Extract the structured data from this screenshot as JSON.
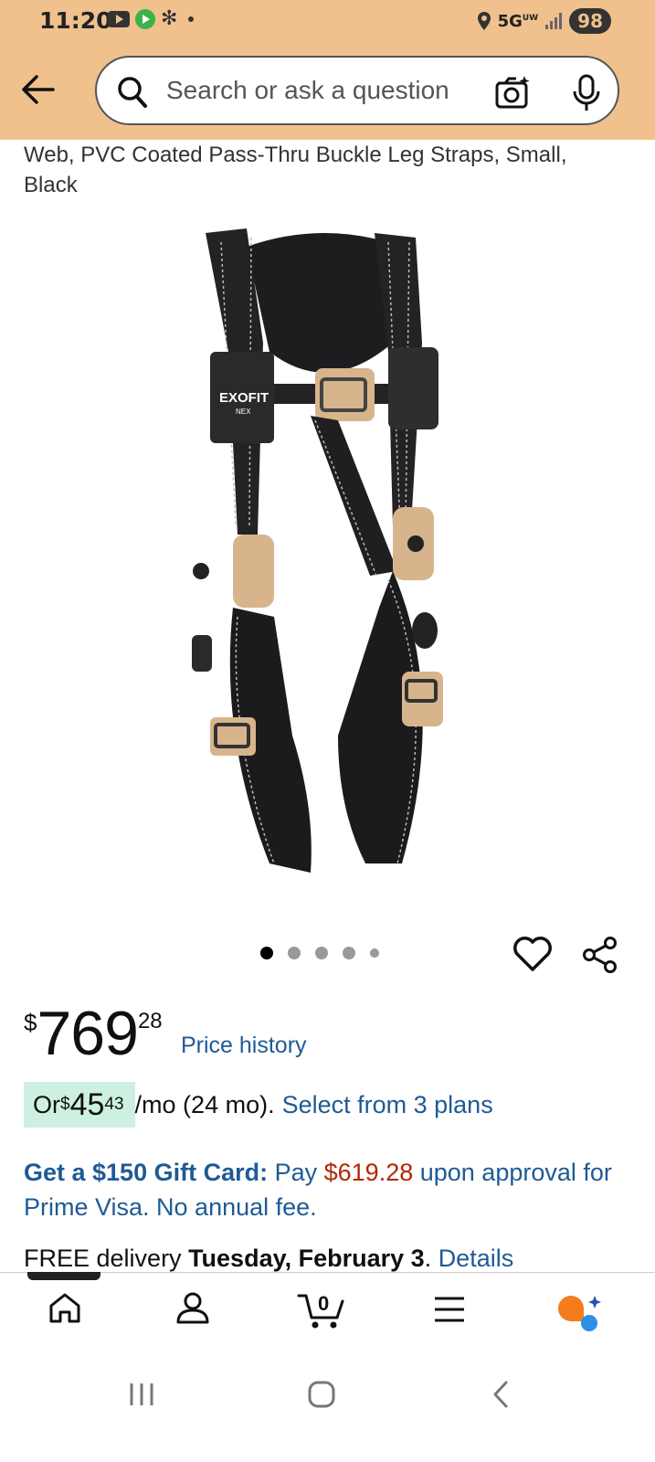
{
  "status_bar": {
    "time": "11:20",
    "network": "5G",
    "network_sub": "UW",
    "battery": "98"
  },
  "search": {
    "placeholder": "Search or ask a question"
  },
  "product": {
    "title_partial": "Harness, PVC Coated Alum. Back D-Ring, Nomex/Kevlar Web, PVC Coated Pass-Thru Buckle Leg Straps, Small, Black",
    "brand_on_image": "EXOFIT",
    "brand_sub_on_image": "NEX",
    "image_count": 5,
    "active_image": 1
  },
  "price": {
    "currency": "$",
    "whole": "769",
    "fraction": "28",
    "history_link": "Price history"
  },
  "monthly": {
    "prefix": "Or ",
    "currency": "$",
    "whole": "45",
    "fraction": "43",
    "suffix": "/mo (24 mo).",
    "link": "Select from 3 plans"
  },
  "gift": {
    "bold": "Get a $150 Gift Card:",
    "pay": " Pay ",
    "amount": "$619.28",
    "rest": " upon approval for Prime Visa. No annual fee."
  },
  "delivery": {
    "free": "FREE",
    "text": " delivery ",
    "date": "Tuesday, February 3",
    "period": ". ",
    "link": "Details"
  },
  "bottom_nav": {
    "cart_count": "0",
    "items": [
      "home-icon",
      "account-icon",
      "cart-icon",
      "menu-icon",
      "rufus-icon"
    ]
  },
  "colors": {
    "header_bg": "#f0c18d",
    "link": "#1f5a96",
    "price_red": "#b12704",
    "installment_bg": "#cdf0e1"
  }
}
